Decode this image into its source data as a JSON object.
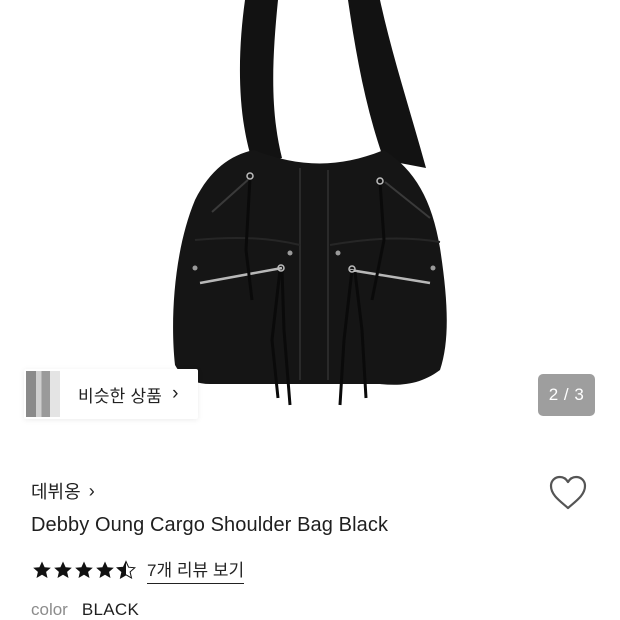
{
  "gallery": {
    "similar_label": "비슷한 상품",
    "page_indicator": "2 / 3"
  },
  "product": {
    "brand": "데뷔옹",
    "title": "Debby Oung Cargo Shoulder Bag Black",
    "rating": 4.5,
    "review_link": "7개 리뷰 보기",
    "color_label": "color",
    "color_value": "BLACK"
  },
  "icons": {
    "wishlist": "heart-outline-icon",
    "brand_chevron": "chevron-right-icon",
    "similar_chevron": "chevron-right-icon",
    "star": "star-icon"
  },
  "colors": {
    "accent": "#111111",
    "indicator_bg": "#9e9e9e",
    "muted_text": "#8c8c8c"
  }
}
